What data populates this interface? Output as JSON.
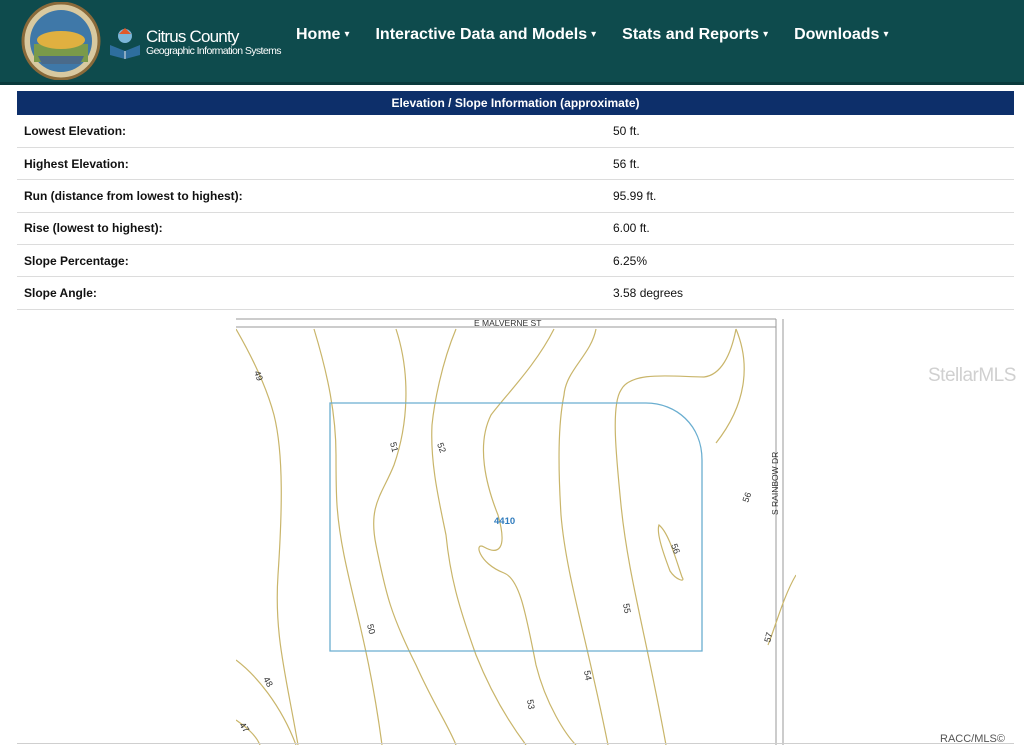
{
  "header": {
    "brand_title": "Citrus County",
    "brand_subtitle": "Geographic Information Systems",
    "nav": [
      {
        "label": "Home"
      },
      {
        "label": "Interactive Data and Models"
      },
      {
        "label": "Stats and Reports"
      },
      {
        "label": "Downloads"
      }
    ],
    "colors": {
      "header_bg": "#0e4b4d",
      "panel_head_bg": "#0d2f6a",
      "contour": "#c9b56a",
      "parcel": "#6aaed0"
    }
  },
  "elevation_panel": {
    "title": "Elevation / Slope Information (approximate)",
    "rows": [
      {
        "label": "Lowest Elevation:",
        "value": "50 ft."
      },
      {
        "label": "Highest Elevation:",
        "value": "56 ft."
      },
      {
        "label": "Run (distance from lowest to highest):",
        "value": "95.99 ft."
      },
      {
        "label": "Rise (lowest to highest):",
        "value": "6.00 ft."
      },
      {
        "label": "Slope Percentage:",
        "value": "6.25%"
      },
      {
        "label": "Slope Angle:",
        "value": "3.58 degrees"
      }
    ]
  },
  "map": {
    "street_north": "E MALVERNE ST",
    "street_east": "S RAINBOW DR",
    "parcel_label": "4410",
    "contour_labels": [
      "49",
      "51",
      "52",
      "50",
      "48",
      "47",
      "53",
      "54",
      "55",
      "56",
      "56",
      "57"
    ]
  },
  "watermark": "StellarMLS",
  "credit": "RACC/MLS©"
}
